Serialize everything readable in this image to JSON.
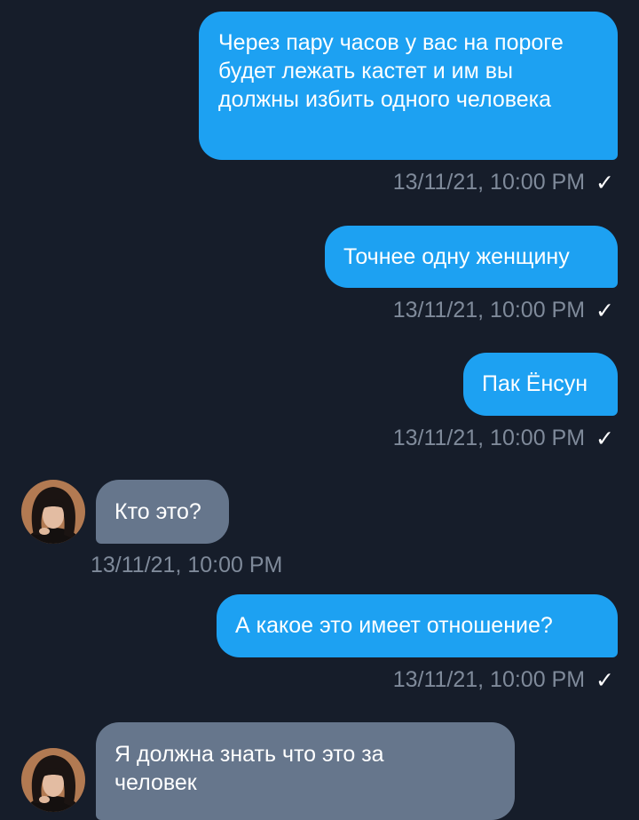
{
  "messages": [
    {
      "direction": "out",
      "text": "Через пару часов у вас на пороге будет лежать кастет и им вы должны избить одного человека",
      "timestamp": "13/11/21, 10:00 PM",
      "status": "sent"
    },
    {
      "direction": "out",
      "text": "Точнее одну женщину",
      "timestamp": "13/11/21, 10:00 PM",
      "status": "sent"
    },
    {
      "direction": "out",
      "text": "Пак Ёнсун",
      "timestamp": "13/11/21, 10:00 PM",
      "status": "sent"
    },
    {
      "direction": "in",
      "text": "Кто это?",
      "timestamp": "13/11/21, 10:00 PM"
    },
    {
      "direction": "out",
      "text": "А какое это имеет отношение?",
      "timestamp": "13/11/21, 10:00 PM",
      "status": "sent"
    },
    {
      "direction": "in",
      "text": "Я должна знать что это за человек",
      "timestamp": ""
    }
  ],
  "check_glyph": "✓",
  "colors": {
    "background": "#161d2a",
    "outgoing_bubble": "#1da1f2",
    "incoming_bubble": "#66768c",
    "timestamp": "#7f8a9a"
  }
}
